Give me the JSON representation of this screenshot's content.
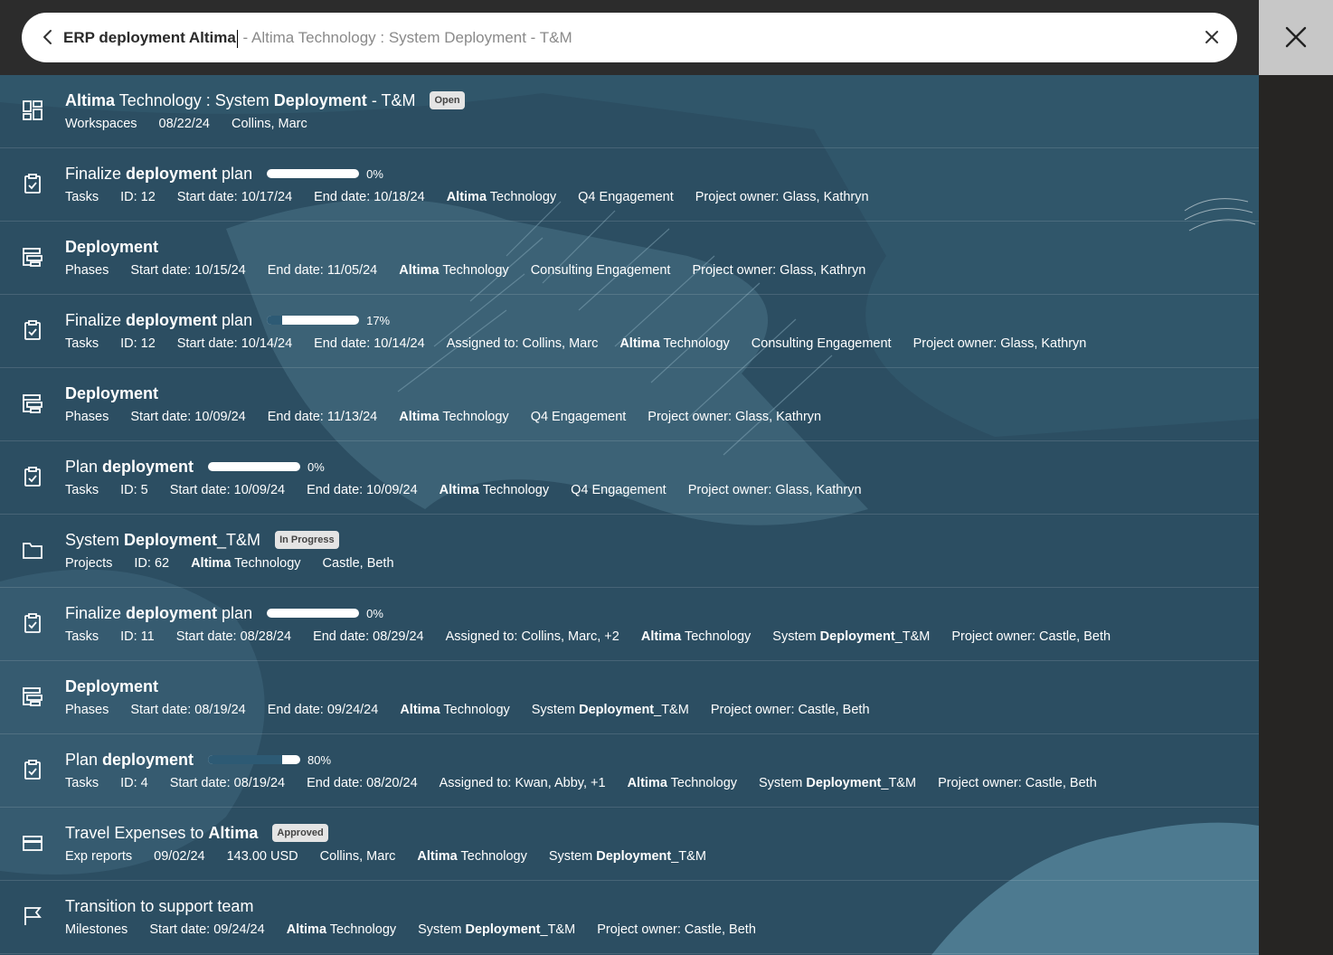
{
  "search": {
    "typed": "ERP deployment Altima",
    "suggestion": " - Altima Technology : System Deployment - T&M"
  },
  "icons": {
    "back": "chevron-left-icon",
    "clear": "close-icon",
    "close_panel": "close-icon",
    "workspace": "dashboard-icon",
    "task": "clipboard-check-icon",
    "phase": "hierarchy-icon",
    "project": "folder-icon",
    "expense": "credit-card-icon",
    "milestone": "flag-icon"
  },
  "colors": {
    "background": "#2c4e62",
    "badge": "#e4e4e4",
    "progress_fill": "#2d5a74"
  },
  "results": [
    {
      "type": "workspace",
      "title": [
        {
          "t": "Altima",
          "b": true
        },
        {
          "t": " Technology : System ",
          "b": false
        },
        {
          "t": "Deployment",
          "b": true
        },
        {
          "t": " - T&M",
          "b": false
        }
      ],
      "badge": "Open",
      "meta": [
        [
          {
            "t": "Workspaces"
          }
        ],
        [
          {
            "t": "08/22/24"
          }
        ],
        [
          {
            "t": "Collins, Marc"
          }
        ]
      ]
    },
    {
      "type": "task",
      "title": [
        {
          "t": "Finalize ",
          "b": false
        },
        {
          "t": "deployment",
          "b": true
        },
        {
          "t": " plan",
          "b": false
        }
      ],
      "progress": 0,
      "progress_label": "0%",
      "meta": [
        [
          {
            "t": "Tasks"
          }
        ],
        [
          {
            "t": "ID: 12"
          }
        ],
        [
          {
            "t": "Start date: 10/17/24"
          }
        ],
        [
          {
            "t": "End date: 10/18/24"
          }
        ],
        [
          {
            "t": "Altima",
            "b": true
          },
          {
            "t": " Technology"
          }
        ],
        [
          {
            "t": "Q4 Engagement"
          }
        ],
        [
          {
            "t": "Project owner: Glass, Kathryn"
          }
        ]
      ]
    },
    {
      "type": "phase",
      "title": [
        {
          "t": "Deployment",
          "b": true
        }
      ],
      "meta": [
        [
          {
            "t": "Phases"
          }
        ],
        [
          {
            "t": "Start date: 10/15/24"
          }
        ],
        [
          {
            "t": "End date: 11/05/24"
          }
        ],
        [
          {
            "t": "Altima",
            "b": true
          },
          {
            "t": " Technology"
          }
        ],
        [
          {
            "t": "Consulting Engagement"
          }
        ],
        [
          {
            "t": "Project owner: Glass, Kathryn"
          }
        ]
      ]
    },
    {
      "type": "task",
      "title": [
        {
          "t": "Finalize ",
          "b": false
        },
        {
          "t": "deployment",
          "b": true
        },
        {
          "t": " plan",
          "b": false
        }
      ],
      "progress": 17,
      "progress_label": "17%",
      "meta": [
        [
          {
            "t": "Tasks"
          }
        ],
        [
          {
            "t": "ID: 12"
          }
        ],
        [
          {
            "t": "Start date: 10/14/24"
          }
        ],
        [
          {
            "t": "End date: 10/14/24"
          }
        ],
        [
          {
            "t": "Assigned to: Collins, Marc"
          }
        ],
        [
          {
            "t": "Altima",
            "b": true
          },
          {
            "t": " Technology"
          }
        ],
        [
          {
            "t": "Consulting Engagement"
          }
        ],
        [
          {
            "t": "Project owner: Glass, Kathryn"
          }
        ]
      ]
    },
    {
      "type": "phase",
      "title": [
        {
          "t": "Deployment",
          "b": true
        }
      ],
      "meta": [
        [
          {
            "t": "Phases"
          }
        ],
        [
          {
            "t": "Start date: 10/09/24"
          }
        ],
        [
          {
            "t": "End date: 11/13/24"
          }
        ],
        [
          {
            "t": "Altima",
            "b": true
          },
          {
            "t": " Technology"
          }
        ],
        [
          {
            "t": "Q4 Engagement"
          }
        ],
        [
          {
            "t": "Project owner: Glass, Kathryn"
          }
        ]
      ]
    },
    {
      "type": "task",
      "title": [
        {
          "t": "Plan ",
          "b": false
        },
        {
          "t": "deployment",
          "b": true
        }
      ],
      "progress": 0,
      "progress_label": "0%",
      "meta": [
        [
          {
            "t": "Tasks"
          }
        ],
        [
          {
            "t": "ID: 5"
          }
        ],
        [
          {
            "t": "Start date: 10/09/24"
          }
        ],
        [
          {
            "t": "End date: 10/09/24"
          }
        ],
        [
          {
            "t": "Altima",
            "b": true
          },
          {
            "t": " Technology"
          }
        ],
        [
          {
            "t": "Q4 Engagement"
          }
        ],
        [
          {
            "t": "Project owner: Glass, Kathryn"
          }
        ]
      ]
    },
    {
      "type": "project",
      "title": [
        {
          "t": "System ",
          "b": false
        },
        {
          "t": "Deployment",
          "b": true
        },
        {
          "t": "_T&M",
          "b": false
        }
      ],
      "badge": "In Progress",
      "meta": [
        [
          {
            "t": "Projects"
          }
        ],
        [
          {
            "t": "ID: 62"
          }
        ],
        [
          {
            "t": "Altima",
            "b": true
          },
          {
            "t": " Technology"
          }
        ],
        [
          {
            "t": "Castle, Beth"
          }
        ]
      ]
    },
    {
      "type": "task",
      "title": [
        {
          "t": "Finalize ",
          "b": false
        },
        {
          "t": "deployment",
          "b": true
        },
        {
          "t": " plan",
          "b": false
        }
      ],
      "progress": 0,
      "progress_label": "0%",
      "meta": [
        [
          {
            "t": "Tasks"
          }
        ],
        [
          {
            "t": "ID: 11"
          }
        ],
        [
          {
            "t": "Start date: 08/28/24"
          }
        ],
        [
          {
            "t": "End date: 08/29/24"
          }
        ],
        [
          {
            "t": "Assigned to: Collins, Marc, +2"
          }
        ],
        [
          {
            "t": "Altima",
            "b": true
          },
          {
            "t": " Technology"
          }
        ],
        [
          {
            "t": "System "
          },
          {
            "t": "Deployment",
            "b": true
          },
          {
            "t": "_T&M"
          }
        ],
        [
          {
            "t": "Project owner: Castle, Beth"
          }
        ]
      ]
    },
    {
      "type": "phase",
      "title": [
        {
          "t": "Deployment",
          "b": true
        }
      ],
      "meta": [
        [
          {
            "t": "Phases"
          }
        ],
        [
          {
            "t": "Start date: 08/19/24"
          }
        ],
        [
          {
            "t": "End date: 09/24/24"
          }
        ],
        [
          {
            "t": "Altima",
            "b": true
          },
          {
            "t": " Technology"
          }
        ],
        [
          {
            "t": "System "
          },
          {
            "t": "Deployment",
            "b": true
          },
          {
            "t": "_T&M"
          }
        ],
        [
          {
            "t": "Project owner: Castle, Beth"
          }
        ]
      ]
    },
    {
      "type": "task",
      "title": [
        {
          "t": "Plan ",
          "b": false
        },
        {
          "t": "deployment",
          "b": true
        }
      ],
      "progress": 80,
      "progress_label": "80%",
      "meta": [
        [
          {
            "t": "Tasks"
          }
        ],
        [
          {
            "t": "ID: 4"
          }
        ],
        [
          {
            "t": "Start date: 08/19/24"
          }
        ],
        [
          {
            "t": "End date: 08/20/24"
          }
        ],
        [
          {
            "t": "Assigned to: Kwan, Abby, +1"
          }
        ],
        [
          {
            "t": "Altima",
            "b": true
          },
          {
            "t": " Technology"
          }
        ],
        [
          {
            "t": "System "
          },
          {
            "t": "Deployment",
            "b": true
          },
          {
            "t": "_T&M"
          }
        ],
        [
          {
            "t": "Project owner: Castle, Beth"
          }
        ]
      ]
    },
    {
      "type": "expense",
      "title": [
        {
          "t": "Travel Expenses to ",
          "b": false
        },
        {
          "t": "Altima",
          "b": true
        }
      ],
      "badge": "Approved",
      "meta": [
        [
          {
            "t": "Exp reports"
          }
        ],
        [
          {
            "t": "09/02/24"
          }
        ],
        [
          {
            "t": "143.00 USD"
          }
        ],
        [
          {
            "t": "Collins, Marc"
          }
        ],
        [
          {
            "t": "Altima",
            "b": true
          },
          {
            "t": " Technology"
          }
        ],
        [
          {
            "t": "System "
          },
          {
            "t": "Deployment",
            "b": true
          },
          {
            "t": "_T&M"
          }
        ]
      ]
    },
    {
      "type": "milestone",
      "title": [
        {
          "t": "Transition to support team",
          "b": false
        }
      ],
      "meta": [
        [
          {
            "t": "Milestones"
          }
        ],
        [
          {
            "t": "Start date: 09/24/24"
          }
        ],
        [
          {
            "t": "Altima",
            "b": true
          },
          {
            "t": " Technology"
          }
        ],
        [
          {
            "t": "System "
          },
          {
            "t": "Deployment",
            "b": true
          },
          {
            "t": "_T&M"
          }
        ],
        [
          {
            "t": "Project owner: Castle, Beth"
          }
        ]
      ]
    }
  ]
}
